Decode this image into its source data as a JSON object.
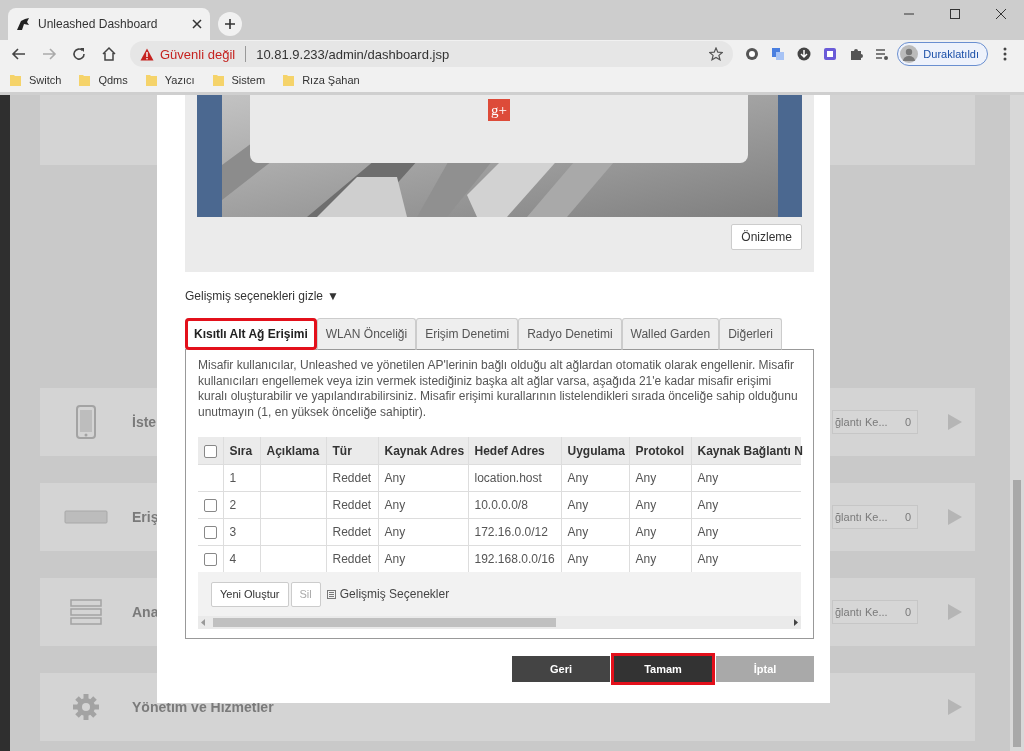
{
  "browser": {
    "tab_title": "Unleashed Dashboard",
    "security_label": "Güvenli değil",
    "url": "10.81.9.233/admin/dashboard.jsp",
    "profile_label": "Duraklatıldı",
    "bookmarks": [
      "Switch",
      "Qdms",
      "Yazıcı",
      "Sistem",
      "Rıza Şahan"
    ]
  },
  "background_cards": [
    {
      "kind": "phone",
      "label": "İste",
      "field_text": "ğlantı Ke...",
      "field_count": "0"
    },
    {
      "kind": "access-point",
      "label": "Eriş",
      "field_text": "ğlantı Ke...",
      "field_count": "0"
    },
    {
      "kind": "server",
      "label": "Ana",
      "field_text": "ğlantı Ke...",
      "field_count": "0"
    },
    {
      "kind": "gear",
      "label": "Yönetim ve Hizmetler"
    }
  ],
  "dialog": {
    "preview": {
      "badge": "g+",
      "button": "Önizleme"
    },
    "advanced_toggle": {
      "label": "Gelişmiş seçenekleri gizle",
      "arrow": "▼"
    },
    "tabs": [
      {
        "label": "Kısıtlı Alt Ağ Erişimi",
        "selected": true,
        "highlighted": true
      },
      {
        "label": "WLAN Önceliği",
        "selected": false,
        "highlighted": false
      },
      {
        "label": "Erişim Denetimi",
        "selected": false,
        "highlighted": false
      },
      {
        "label": "Radyo Denetimi",
        "selected": false,
        "highlighted": false
      },
      {
        "label": "Walled Garden",
        "selected": false,
        "highlighted": false
      },
      {
        "label": "Diğerleri",
        "selected": false,
        "highlighted": false
      }
    ],
    "description": "Misafir kullanıcılar, Unleashed ve yönetilen AP'lerinin bağlı olduğu alt ağlardan otomatik olarak engellenir. Misafir kullanıcıları engellemek veya izin vermek istediğiniz başka alt ağlar varsa, aşağıda 21'e kadar misafir erişimi kuralı oluşturabilir ve yapılandırabilirsiniz. Misafir erişimi kurallarının listelendikleri sırada önceliğe sahip olduğunu unutmayın (1, en yüksek önceliğe sahiptir).",
    "table": {
      "select_all_checked": false,
      "columns": [
        "Sıra",
        "Açıklama",
        "Tür",
        "Kaynak Adres",
        "Hedef Adres",
        "Uygulama",
        "Protokol",
        "Kaynak Bağlantı N"
      ],
      "rows": [
        {
          "selectable": false,
          "cells": [
            "1",
            "",
            "Reddet",
            "Any",
            "location.host",
            "Any",
            "Any",
            "Any"
          ]
        },
        {
          "selectable": true,
          "checked": false,
          "cells": [
            "2",
            "",
            "Reddet",
            "Any",
            "10.0.0.0/8",
            "Any",
            "Any",
            "Any"
          ]
        },
        {
          "selectable": true,
          "checked": false,
          "cells": [
            "3",
            "",
            "Reddet",
            "Any",
            "172.16.0.0/12",
            "Any",
            "Any",
            "Any"
          ]
        },
        {
          "selectable": true,
          "checked": false,
          "cells": [
            "4",
            "",
            "Reddet",
            "Any",
            "192.168.0.0/16",
            "Any",
            "Any",
            "Any"
          ]
        }
      ]
    },
    "table_actions": {
      "create": "Yeni Oluştur",
      "delete": {
        "label": "Sil",
        "disabled": true
      },
      "advanced": "Gelişmiş Seçenekler"
    },
    "buttons": [
      {
        "label": "Geri",
        "kind": "dark",
        "highlighted": false
      },
      {
        "label": "Tamam",
        "kind": "dark",
        "highlighted": true
      },
      {
        "label": "İptal",
        "kind": "muted",
        "highlighted": false
      }
    ]
  }
}
